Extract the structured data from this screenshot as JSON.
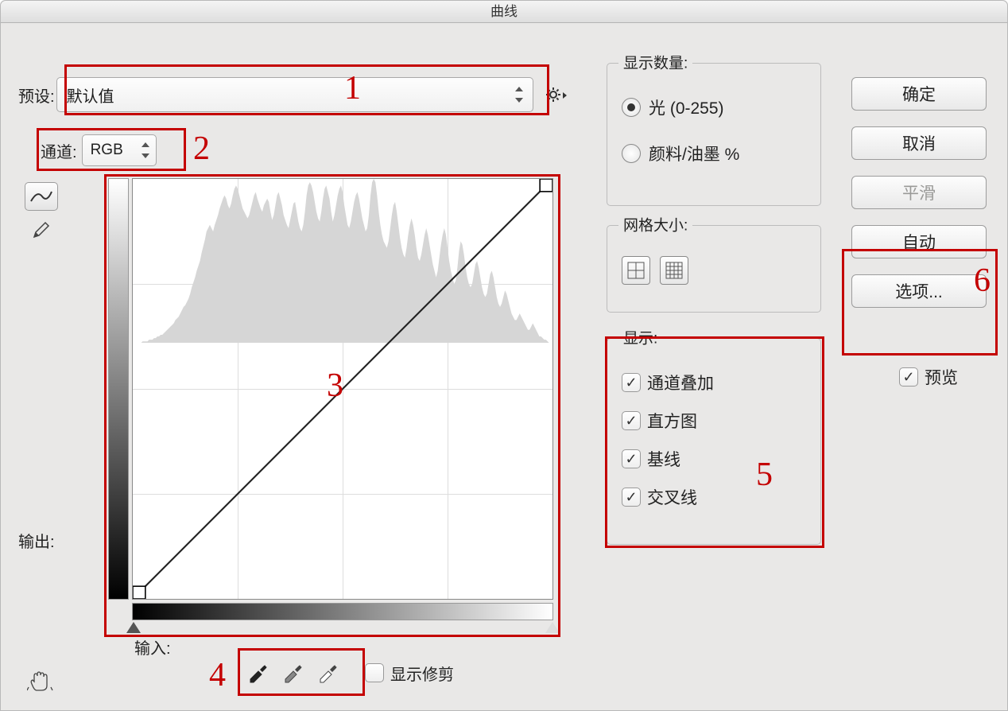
{
  "title": "曲线",
  "preset": {
    "label": "预设:",
    "value": "默认值"
  },
  "channel": {
    "label": "通道:",
    "value": "RGB"
  },
  "output_label": "输出:",
  "input_label": "输入:",
  "show_clipping": "显示修剪",
  "display_amount": {
    "title": "显示数量:",
    "opt_light": "光 (0-255)",
    "opt_pigment": "颜料/油墨 %"
  },
  "grid_size": {
    "title": "网格大小:"
  },
  "show": {
    "title": "显示:",
    "overlay": "通道叠加",
    "histogram": "直方图",
    "baseline": "基线",
    "intersection": "交叉线"
  },
  "buttons": {
    "ok": "确定",
    "cancel": "取消",
    "smooth": "平滑",
    "auto": "自动",
    "options": "选项..."
  },
  "preview": "预览",
  "annotations": {
    "1": "1",
    "2": "2",
    "3": "3",
    "4": "4",
    "5": "5",
    "6": "6"
  },
  "chart_data": {
    "type": "line",
    "title": "曲线 (Curves)",
    "xlabel": "输入",
    "ylabel": "输出",
    "xlim": [
      0,
      255
    ],
    "ylim": [
      0,
      255
    ],
    "series": [
      {
        "name": "curve",
        "x": [
          0,
          255
        ],
        "y": [
          0,
          255
        ]
      }
    ],
    "histogram": [
      0,
      0,
      0,
      0,
      0,
      0,
      1,
      1,
      1,
      1,
      2,
      2,
      2,
      3,
      3,
      4,
      4,
      5,
      5,
      6,
      7,
      8,
      9,
      10,
      11,
      12,
      14,
      15,
      16,
      18,
      20,
      22,
      23,
      25,
      27,
      30,
      34,
      37,
      40,
      44,
      47,
      50,
      55,
      59,
      63,
      68,
      70,
      72,
      70,
      68,
      72,
      75,
      78,
      82,
      85,
      88,
      90,
      88,
      84,
      82,
      85,
      90,
      94,
      96,
      94,
      90,
      86,
      82,
      80,
      78,
      76,
      78,
      82,
      86,
      90,
      92,
      88,
      85,
      82,
      80,
      84,
      86,
      88,
      86,
      80,
      75,
      78,
      84,
      90,
      92,
      88,
      84,
      78,
      75,
      72,
      70,
      75,
      80,
      85,
      86,
      80,
      74,
      70,
      68,
      72,
      80,
      90,
      96,
      98,
      96,
      92,
      86,
      80,
      76,
      74,
      80,
      88,
      94,
      96,
      92,
      88,
      80,
      74,
      78,
      84,
      90,
      94,
      96,
      92,
      84,
      78,
      72,
      70,
      74,
      80,
      86,
      90,
      92,
      88,
      82,
      76,
      72,
      68,
      70,
      78,
      90,
      98,
      100,
      98,
      90,
      80,
      72,
      66,
      62,
      60,
      58,
      62,
      70,
      78,
      84,
      86,
      80,
      72,
      64,
      58,
      54,
      52,
      58,
      66,
      72,
      76,
      72,
      66,
      58,
      52,
      50,
      54,
      60,
      66,
      70,
      66,
      60,
      54,
      48,
      44,
      40,
      44,
      52,
      60,
      66,
      70,
      66,
      58,
      50,
      44,
      40,
      36,
      38,
      46,
      56,
      62,
      60,
      54,
      46,
      40,
      36,
      34,
      36,
      42,
      48,
      50,
      46,
      40,
      34,
      30,
      28,
      30,
      36,
      42,
      44,
      40,
      34,
      28,
      24,
      22,
      24,
      28,
      32,
      30,
      26,
      22,
      18,
      16,
      14,
      14,
      16,
      18,
      16,
      14,
      12,
      10,
      8,
      8,
      10,
      12,
      10,
      8,
      6,
      4,
      4,
      3,
      2,
      2,
      1,
      0,
      0
    ]
  }
}
